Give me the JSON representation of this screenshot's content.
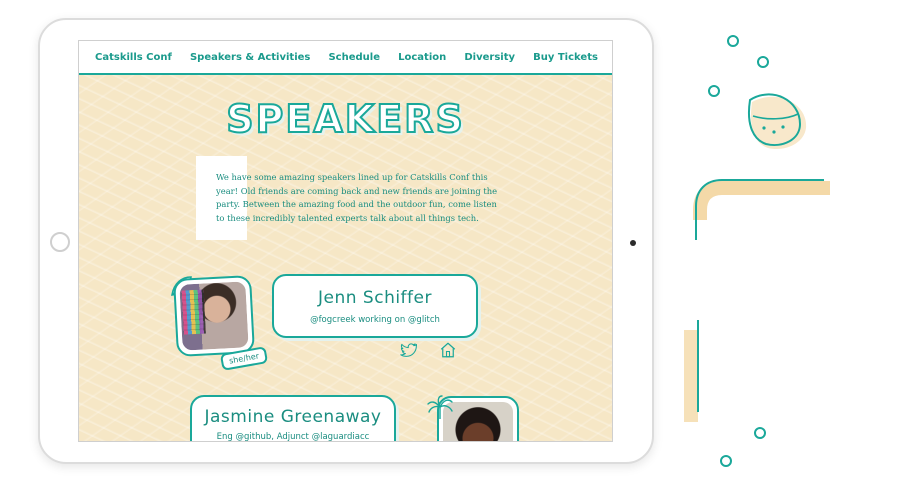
{
  "nav": {
    "items": [
      {
        "label": "Catskills Conf"
      },
      {
        "label": "Speakers & Activities"
      },
      {
        "label": "Schedule"
      },
      {
        "label": "Location"
      },
      {
        "label": "Diversity"
      },
      {
        "label": "Buy Tickets"
      }
    ]
  },
  "page": {
    "title": "SPEAKERS",
    "intro": "We have some amazing speakers lined up for Catskills Conf this year! Old friends are coming back and new friends are joining the party. Between the amazing food and the outdoor fun, come listen to these incredibly talented experts talk about all things tech."
  },
  "speakers": [
    {
      "name": "Jenn Schiffer",
      "affiliation": "@fogcreek working on @glitch",
      "pronouns": "she/her",
      "icons": [
        "twitter-icon",
        "home-icon"
      ]
    },
    {
      "name": "Jasmine Greenaway",
      "affiliation": "Eng @github, Adjunct @laguardiacc"
    }
  ],
  "colors": {
    "accent": "#1aa89a",
    "background": "#f6e7c6",
    "text": "#1a8d80",
    "decoration_orange": "#f4d9a8"
  }
}
